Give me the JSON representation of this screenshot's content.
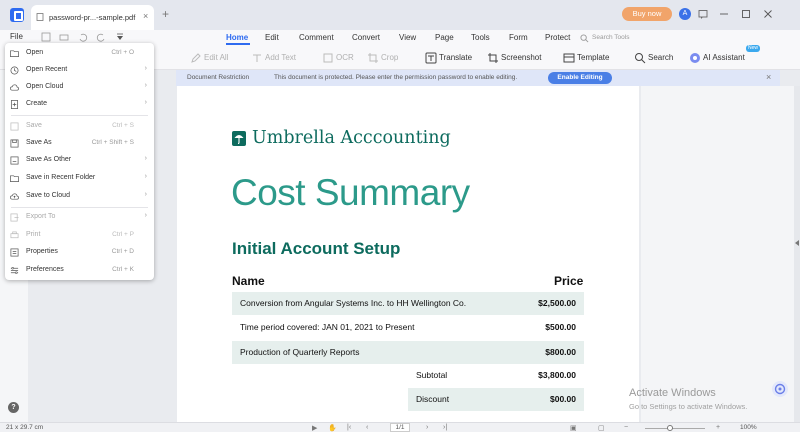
{
  "tab_title": "password-pr...-sample.pdf",
  "buy_now": "Buy now",
  "avatar_initial": "A",
  "menu": {
    "file": "File",
    "tabs": [
      "Home",
      "Edit",
      "Comment",
      "Convert",
      "View",
      "Page",
      "Tools",
      "Form",
      "Protect"
    ],
    "active_tab": "Home",
    "search_tools": "Search Tools"
  },
  "toolbar": {
    "edit_all": "Edit All",
    "add_text": "Add Text",
    "ocr": "OCR",
    "crop": "Crop",
    "translate": "Translate",
    "screenshot": "Screenshot",
    "template": "Template",
    "search": "Search",
    "ai_assistant": "AI Assistant",
    "ai_badge": "New"
  },
  "notice": {
    "label": "Document Restriction",
    "message": "This document is protected. Please enter the permission password to enable editing.",
    "button": "Enable Editing"
  },
  "file_menu": [
    {
      "label": "Open",
      "shortcut": "Ctrl + O",
      "submenu": false,
      "disabled": false
    },
    {
      "label": "Open Recent",
      "shortcut": "",
      "submenu": true,
      "disabled": false
    },
    {
      "label": "Open Cloud",
      "shortcut": "",
      "submenu": true,
      "disabled": false
    },
    {
      "label": "Create",
      "shortcut": "",
      "submenu": true,
      "disabled": false
    },
    {
      "label": "Save",
      "shortcut": "Ctrl + S",
      "submenu": false,
      "disabled": true
    },
    {
      "label": "Save As",
      "shortcut": "Ctrl + Shift + S",
      "submenu": false,
      "disabled": false
    },
    {
      "label": "Save As Other",
      "shortcut": "",
      "submenu": true,
      "disabled": false
    },
    {
      "label": "Save in Recent Folder",
      "shortcut": "",
      "submenu": true,
      "disabled": false
    },
    {
      "label": "Save to Cloud",
      "shortcut": "",
      "submenu": true,
      "disabled": false
    },
    {
      "label": "Export To",
      "shortcut": "",
      "submenu": true,
      "disabled": true
    },
    {
      "label": "Print",
      "shortcut": "Ctrl + P",
      "submenu": false,
      "disabled": true
    },
    {
      "label": "Properties",
      "shortcut": "Ctrl + D",
      "submenu": false,
      "disabled": false
    },
    {
      "label": "Preferences",
      "shortcut": "Ctrl + K",
      "submenu": false,
      "disabled": false
    }
  ],
  "document": {
    "brand": "Umbrella Acccounting",
    "title": "Cost Summary",
    "subtitle": "Initial Account Setup",
    "col_name": "Name",
    "col_price": "Price",
    "rows": [
      {
        "name": "Conversion from Angular Systems Inc. to HH Wellington Co.",
        "price": "$2,500.00"
      },
      {
        "name": "Time period covered: JAN 01, 2021 to Present",
        "price": "$500.00"
      },
      {
        "name": "Production of Quarterly Reports",
        "price": "$800.00"
      }
    ],
    "summary": [
      {
        "label": "Subtotal",
        "value": "$3,800.00"
      },
      {
        "label": "Discount",
        "value": "$00.00"
      }
    ]
  },
  "watermark": {
    "line1": "Activate Windows",
    "line2": "Go to Settings to activate Windows."
  },
  "status": {
    "page_size": "21 x 29.7 cm",
    "page_num": "1/1",
    "zoom": "100%"
  },
  "colors": {
    "accent": "#2e6bf0",
    "brand_green": "#0d6b5e",
    "title_teal": "#2c9a8a",
    "buy_now": "#f1a46a"
  }
}
